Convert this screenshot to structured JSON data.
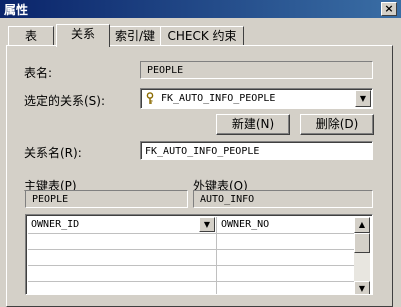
{
  "window": {
    "title": "属性",
    "close_label": "×"
  },
  "tabs": [
    {
      "label": "表",
      "active": false
    },
    {
      "label": "关系",
      "active": true
    },
    {
      "label": "索引/键",
      "active": false
    },
    {
      "label": "CHECK 约束",
      "active": false
    }
  ],
  "form": {
    "table_name_label": "表名:",
    "table_name_value": "PEOPLE",
    "selected_relation_label": "选定的关系(S):",
    "selected_relation_value": "FK_AUTO_INFO_PEOPLE",
    "new_button": "新建(N)",
    "delete_button": "删除(D)",
    "relation_name_label": "关系名(R):",
    "relation_name_value": "FK_AUTO_INFO_PEOPLE",
    "primary_table_label": "主键表(P)",
    "primary_table_value": "PEOPLE",
    "foreign_table_label": "外键表(O)",
    "foreign_table_value": "AUTO_INFO"
  },
  "grid": {
    "rows": [
      {
        "primary": "OWNER_ID",
        "foreign": "OWNER_NO"
      },
      {
        "primary": "",
        "foreign": ""
      },
      {
        "primary": "",
        "foreign": ""
      },
      {
        "primary": "",
        "foreign": ""
      },
      {
        "primary": "",
        "foreign": ""
      }
    ]
  },
  "icons": {
    "title_icon": "properties-icon",
    "relation_icon": "key-icon",
    "dropdown": "chevron-down-icon"
  }
}
